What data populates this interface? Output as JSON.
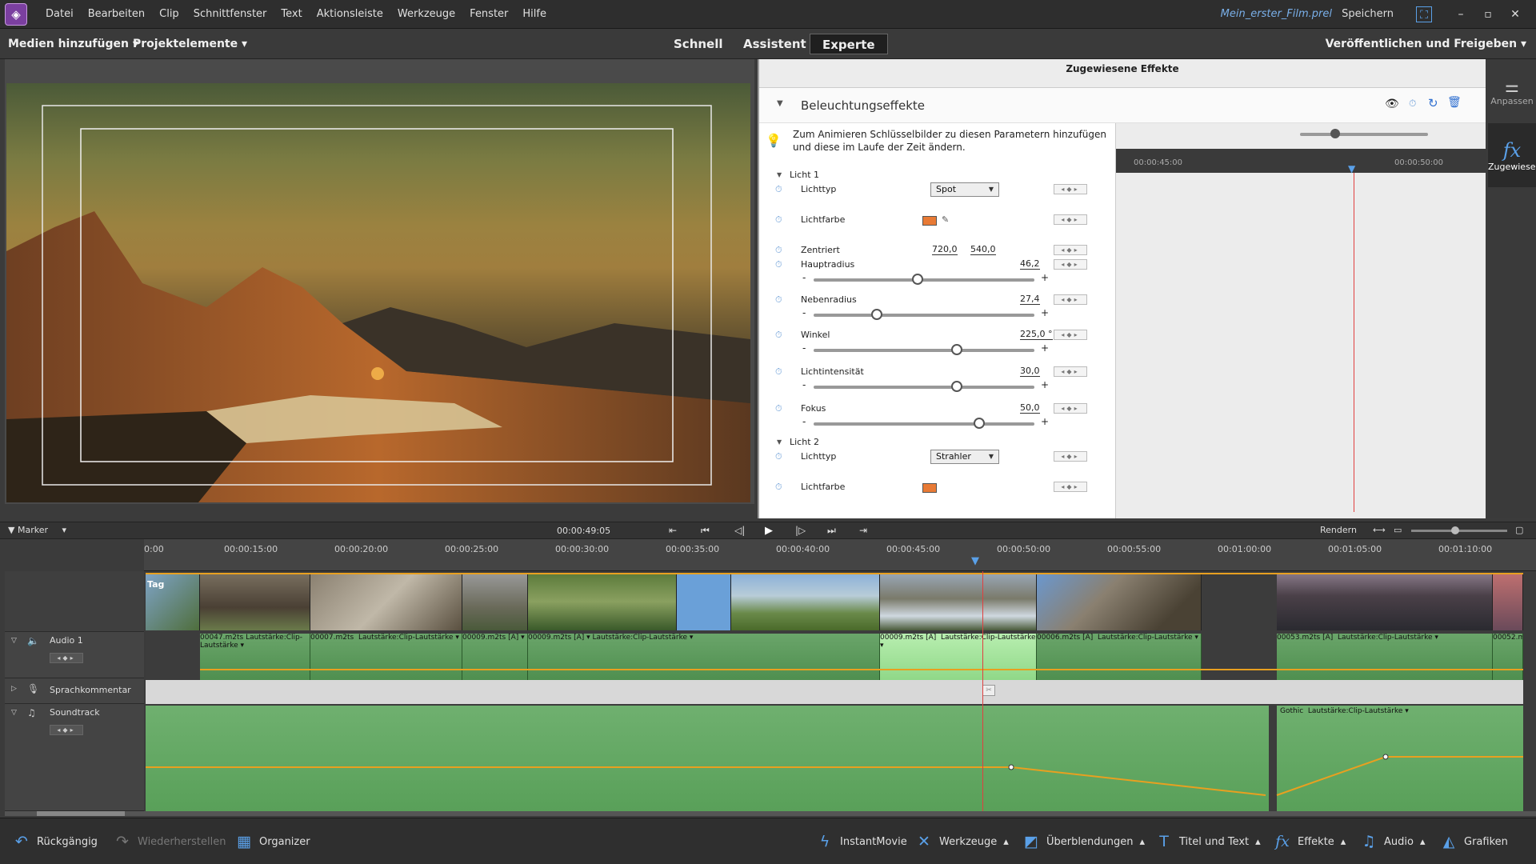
{
  "menubar": {
    "items": [
      "Datei",
      "Bearbeiten",
      "Clip",
      "Schnittfenster",
      "Text",
      "Aktionsleiste",
      "Werkzeuge",
      "Fenster",
      "Hilfe"
    ],
    "filename": "Mein_erster_Film.prel",
    "save": "Speichern"
  },
  "toolbar": {
    "add_media": "Medien hinzufügen",
    "project_assets": "Projektelemente",
    "modes": [
      "Schnell",
      "Assistent",
      "Experte"
    ],
    "active_mode": "Experte",
    "publish": "Veröffentlichen und Freigeben"
  },
  "panel": {
    "title": "Zugewiesene Effekte",
    "section": "Beleuchtungseffekte",
    "tip": "Zum Animieren Schlüsselbilder zu diesen Parametern hinzufügen und diese im Laufe der Zeit ändern.",
    "light1": "Licht 1",
    "light2": "Licht 2",
    "params": {
      "lichttyp": "Lichttyp",
      "lichttyp_val": "Spot",
      "lichtfarbe": "Lichtfarbe",
      "zentriert": "Zentriert",
      "zx": "720,0",
      "zy": "540,0",
      "hauptradius": "Hauptradius",
      "hauptradius_val": "46,2",
      "nebenradius": "Nebenradius",
      "nebenradius_val": "27,4",
      "winkel": "Winkel",
      "winkel_val": "225,0 °",
      "intensitaet": "Lichtintensität",
      "intensitaet_val": "30,0",
      "fokus": "Fokus",
      "fokus_val": "50,0",
      "lichttyp2": "Lichttyp",
      "lichttyp2_val": "Strahler",
      "lichtfarbe2": "Lichtfarbe"
    },
    "kf_times": [
      "00:00:45:00",
      "00:00:50:00"
    ],
    "light_color": "#e87a35"
  },
  "right_strip": {
    "adjust": "Anpassen",
    "applied": "Zugewiese..."
  },
  "transport": {
    "marker": "Marker",
    "timecode": "00:00:49:05",
    "render": "Rendern"
  },
  "timeline": {
    "ruler": [
      "0:00",
      "00:00:15:00",
      "00:00:20:00",
      "00:00:25:00",
      "00:00:30:00",
      "00:00:35:00",
      "00:00:40:00",
      "00:00:45:00",
      "00:00:50:00",
      "00:00:55:00",
      "00:01:00:00",
      "00:01:05:00",
      "00:01:10:00"
    ],
    "tracks": {
      "audio1": "Audio 1",
      "voice": "Sprachkommentar",
      "soundtrack": "Soundtrack"
    },
    "audio_clips": [
      "00047.m2ts",
      "Lautstärke:Clip-Lautstärke",
      "00007.m2ts",
      "Lautstärke:Clip-Lautstärke",
      "00009.m2ts [A]",
      "00009.m2ts [A]",
      "Lautstärke:Clip-Lautstärke",
      "00009.m2ts [A]",
      "Lautstärke:Clip-Lautstärke",
      "00006.m2ts [A]",
      "Lautstärke:Clip-Lautstärke",
      "00053.m2ts [A]",
      "Lautstärke:Clip-Lautstärke",
      "00052.m"
    ],
    "video_first_label": "Tag",
    "soundtrack_clip": "Gothic",
    "soundtrack_vol": "Lautstärke:Clip-Lautstärke"
  },
  "bottombar": {
    "undo": "Rückgängig",
    "redo": "Wiederherstellen",
    "organizer": "Organizer",
    "instantmovie": "InstantMovie",
    "tools": "Werkzeuge",
    "transitions": "Überblendungen",
    "titles": "Titel und Text",
    "effects": "Effekte",
    "audio": "Audio",
    "graphics": "Grafiken"
  }
}
